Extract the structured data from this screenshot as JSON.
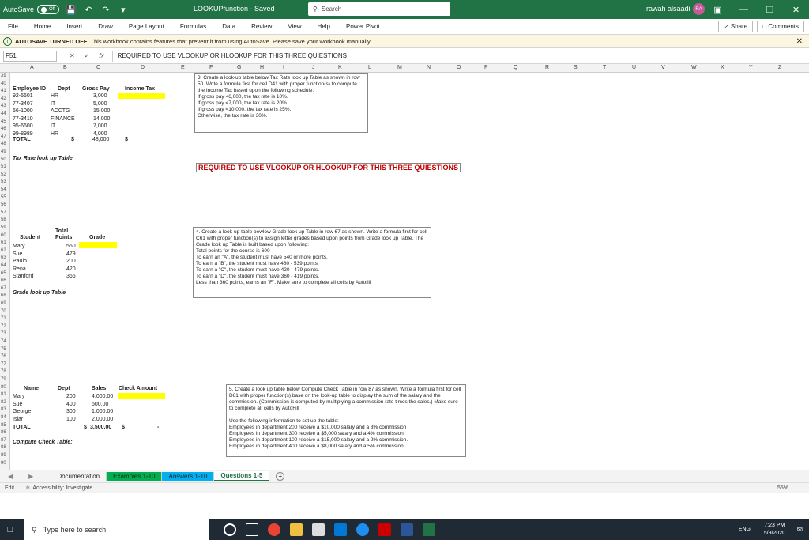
{
  "titlebar": {
    "autosave": "AutoSave",
    "toggle": "Off",
    "doc_title": "LOOKUPfunction - Saved",
    "search": "Search",
    "user": "rawah alsaadi",
    "avatar": "RA"
  },
  "menu": [
    "File",
    "Home",
    "Insert",
    "Draw",
    "Page Layout",
    "Formulas",
    "Data",
    "Review",
    "View",
    "Help",
    "Power Pivot"
  ],
  "share": "Share",
  "comments": "Comments",
  "message": {
    "title": "AUTOSAVE TURNED OFF",
    "text": "This workbook contains features that prevent it from using AutoSave. Please save your workbook manually."
  },
  "formula": {
    "cell": "F51",
    "text": "REQUIRED TO USE VLOOKUP OR HLOOKUP FOR THIS THREE QUIESTIONS"
  },
  "columns": [
    "A",
    "B",
    "C",
    "D",
    "E",
    "F",
    "G",
    "H",
    "I",
    "J",
    "K",
    "L",
    "M",
    "N",
    "O",
    "P",
    "Q",
    "R",
    "S",
    "T",
    "U",
    "V",
    "W",
    "X",
    "Y",
    "Z"
  ],
  "rows": [
    "39",
    "40",
    "41",
    "42",
    "43",
    "44",
    "45",
    "46",
    "47",
    "48",
    "49",
    "50",
    "51",
    "52",
    "53",
    "54",
    "55",
    "56",
    "57",
    "58",
    "59",
    "60",
    "61",
    "62",
    "63",
    "64",
    "65",
    "66",
    "67",
    "68",
    "69",
    "70",
    "71",
    "72",
    "73",
    "74",
    "75",
    "76",
    "77",
    "78",
    "79",
    "80",
    "81",
    "82",
    "83",
    "84",
    "85",
    "86",
    "87",
    "88",
    "89",
    "90"
  ],
  "table1": {
    "headers": [
      "Employee ID",
      "Dept",
      "Gross Pay",
      "Income Tax"
    ],
    "rows": [
      [
        "92-5601",
        "HR",
        "3,000"
      ],
      [
        "77-3407",
        "IT",
        "5,000"
      ],
      [
        "66-1000",
        "ACCTG",
        "15,000"
      ],
      [
        "77-3410",
        "FINANCE",
        "14,000"
      ],
      [
        "95-6600",
        "IT",
        "7,000"
      ],
      [
        "99-8989",
        "HR",
        "4,000"
      ]
    ],
    "total_label": "TOTAL",
    "total_dollar": "$",
    "total_value": "48,000",
    "total_tax": "$",
    "lookup_title": "Tax Rate look up Table"
  },
  "q3": {
    "num": "3.",
    "text": "Create a look-up table below Tax Rate look up Table as shown in row 50. Write a formula first for cell D41 with proper function(s) to compute the Income Tax based upon the following schedule:\nIf gross pay <6,000, the tax rate is 10%.\nIf gross pay <7,000, the tax rate is 20%\nIf gross pay <10,000, the tax rate is 25%.\nOtherwise, the tax rate is 30%."
  },
  "required": "REQUIRED TO USE VLOOKUP OR HLOOKUP FOR THIS THREE QUIESTIONS",
  "table2": {
    "headers": [
      "Student",
      "Total Points",
      "Grade"
    ],
    "rows": [
      [
        "Mary",
        "550"
      ],
      [
        "Sue",
        "479"
      ],
      [
        "Paulo",
        "200"
      ],
      [
        "Rena",
        "420"
      ],
      [
        "Stanford",
        "366"
      ]
    ],
    "lookup_title": "Grade look up Table"
  },
  "q4": {
    "text": "4. Create a look-up table bewlow Grade look up Table in row 67 as shown. Write a formula first for cell C61 with proper function(s) to assign letter grades based upon points from Grade look up Table. The Grade look up Table is built based upon following:\nTotal points for the course is 600\nTo earn an \"A\", the student must have 540 or more points.\nTo earn a \"B\", the student must have 480 - 539 points.\nTo earn a \"C\", the student must have 420 - 479 points.\nTo earn a \"D\", the student must have 360 - 419 points.\nLess than 360 points, earns an \"F\". Make sure to complete all cells by Autofill"
  },
  "table3": {
    "headers": [
      "Name",
      "Dept",
      "Sales",
      "Check Amount"
    ],
    "rows": [
      [
        "Mary",
        "200",
        "4,000.00"
      ],
      [
        "Sue",
        "400",
        "500.00"
      ],
      [
        "George",
        "300",
        "1,000.00"
      ],
      [
        "Islar",
        "100",
        "2,000.00"
      ]
    ],
    "total_label": "TOTAL",
    "total_dollar": "$",
    "total_value": "3,500.00",
    "total_check": "$",
    "total_dash": "-",
    "lookup_title": "Compute Check Table:"
  },
  "q5": {
    "text": "5. Create a look up table below Compute Check Table in row 87 as shown. Write a formula first for cell D81 with proper function(s) base on the look-up table to display the sum of the salary and the commission. (Commission is computed by multiplying a commission rate times the sales.) Make sure to complete all cells by AutoFill\n\nUse the following information to set up the table:\nEmployees in department 200 receive a $10,000 salary and a 3% commission\nEmployees in department 300 receive a $5,000 salary and a 4% commission.\nEmployees in department 100 receive a $15,000 salary and a 2% commission.\nEmployees in department 400 receive a $8,000 salary and a 5% commission."
  },
  "tabs": [
    "Documentation",
    "Examples 1-10",
    "Answers 1-10",
    "Questions 1-5"
  ],
  "status": {
    "mode": "Edit",
    "accessibility": "Accessibility: Investigate",
    "zoom": "55%"
  },
  "taskbar": {
    "search": "Type here to search",
    "time": "7:23 PM",
    "date": "5/9/2020",
    "lang": "ENG"
  }
}
